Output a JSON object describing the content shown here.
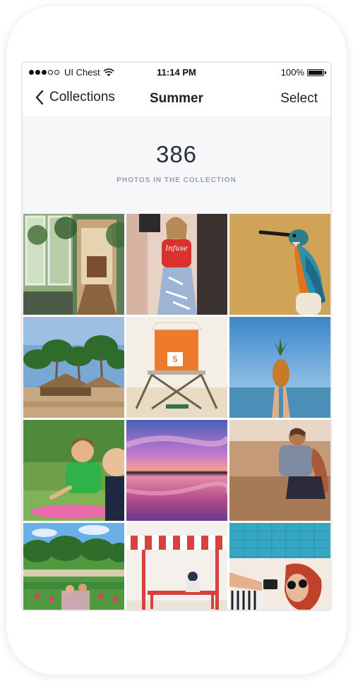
{
  "status_bar": {
    "carrier": "UI Chest",
    "time": "11:14 PM",
    "battery": "100%",
    "battery_level": 1.0,
    "signal_bars": 3
  },
  "nav": {
    "back_label": "Collections",
    "title": "Summer",
    "select_label": "Select"
  },
  "summary": {
    "count": "386",
    "label": "PHOTOS IN THE COLLECTION"
  },
  "photos": [
    {
      "subject": "greenhouse doorway"
    },
    {
      "subject": "woman in red shirt",
      "shirt_text": "Infuse"
    },
    {
      "subject": "kingfisher bird"
    },
    {
      "subject": "palm trees beach huts"
    },
    {
      "subject": "lifeguard tower",
      "tower_number": "5"
    },
    {
      "subject": "pineapple over sea"
    },
    {
      "subject": "children playing"
    },
    {
      "subject": "purple sunset lake"
    },
    {
      "subject": "couple on cliff"
    },
    {
      "subject": "garden with flowers"
    },
    {
      "subject": "striped awning bench"
    },
    {
      "subject": "woman by pool"
    }
  ],
  "colors": {
    "accent_text": "#222222",
    "summary_bg": "#f6f7f9",
    "label_gray": "#9aa0a8"
  }
}
